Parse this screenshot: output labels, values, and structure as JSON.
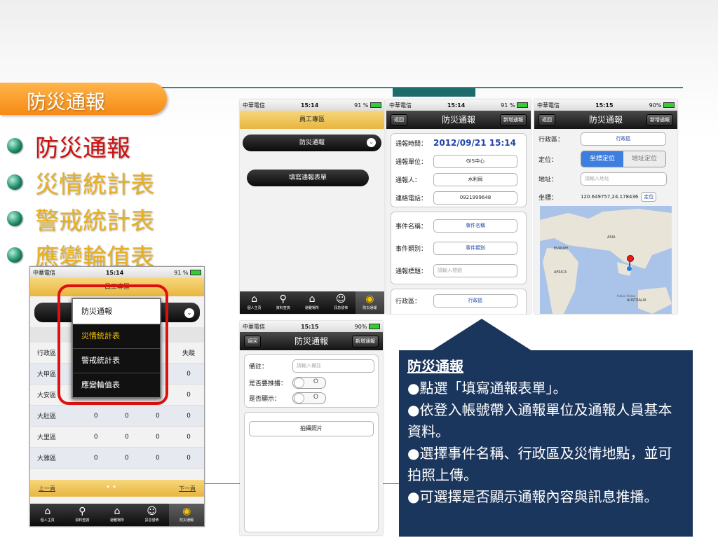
{
  "slide": {
    "title": "防災通報",
    "bullets": [
      {
        "text": "防災通報",
        "color": "#cc1111"
      },
      {
        "text": "災情統計表",
        "color": "#e8b020"
      },
      {
        "text": "警戒統計表",
        "color": "#e8b020"
      },
      {
        "text": "應變輪值表",
        "color": "#e8b020"
      }
    ]
  },
  "status": {
    "carrier": "中華電信",
    "time1": "15:14",
    "time2": "15:15",
    "battery1": "91 %",
    "battery2": "90%"
  },
  "phone_menu": {
    "header": "員工專區",
    "dropdown_items": [
      "防災通報",
      "災情統計表",
      "警戒統計表",
      "應變輪值表"
    ],
    "selected_index": 1,
    "table_rows": [
      {
        "name": "行政區",
        "v": [
          "",
          "",
          "",
          "失蹤"
        ]
      },
      {
        "name": "大甲區",
        "v": [
          "",
          "",
          "",
          "0"
        ]
      },
      {
        "name": "大安區",
        "v": [
          "0",
          "0",
          "0",
          "0"
        ]
      },
      {
        "name": "大肚區",
        "v": [
          "0",
          "0",
          "0",
          "0"
        ]
      },
      {
        "name": "大里區",
        "v": [
          "0",
          "0",
          "0",
          "0"
        ]
      },
      {
        "name": "大雅區",
        "v": [
          "0",
          "0",
          "0",
          "0"
        ]
      }
    ],
    "prev": "上一頁",
    "next": "下一頁"
  },
  "tabbar": [
    "個人主頁",
    "資料查詢",
    "避難場所",
    "訊息發佈",
    "防災通報"
  ],
  "phone_a": {
    "header": "員工專區",
    "select_label": "防災通報",
    "button": "填寫通報表單"
  },
  "phone_b": {
    "back": "返回",
    "title": "防災通報",
    "new": "新增通報",
    "time_label": "通報時間：",
    "time_value": "2012/09/21 15:14",
    "unit_label": "通報單位：",
    "unit_value": "GIS中心",
    "person_label": "通報人：",
    "person_value": "水利局",
    "phone_label": "連絡電話：",
    "phone_value": "0921999648",
    "event_name_label": "事件名稱：",
    "event_name_value": "事件名稱",
    "event_type_label": "事件類別：",
    "event_type_value": "事件類別",
    "subject_label": "通報標題：",
    "subject_placeholder": "請輸入標題",
    "district_label": "行政區：",
    "district_value": "行政區"
  },
  "phone_c": {
    "back": "返回",
    "title": "防災通報",
    "new": "新增通報",
    "district_label": "行政區：",
    "district_value": "行政區",
    "locate_label": "定位：",
    "locate_coord": "坐標定位",
    "locate_addr": "地址定位",
    "address_label": "地址：",
    "address_placeholder": "請輸入地址",
    "coord_label": "坐標：",
    "coord_value": "120.649757,24.178436",
    "coord_btn": "定位",
    "map_labels": [
      "ASIA",
      "EUROPE",
      "AFRICA",
      "AUSTRALIA",
      "Indian Ocean"
    ]
  },
  "phone_d": {
    "back": "返回",
    "title": "防災通報",
    "new": "新增通報",
    "note_label": "備註：",
    "note_placeholder": "請輸入備註",
    "push_label": "是否要推播：",
    "show_label": "是否顯示：",
    "photo_btn": "拍攝照片"
  },
  "callout": {
    "heading": "防災通報",
    "lines": [
      "●點選「填寫通報表單」。",
      "●依登入帳號帶入通報單位及通報人員基本資料。",
      "●選擇事件名稱、行政區及災情地點，並可拍照上傳。",
      "●可選擇是否顯示通報內容與訊息推播。"
    ]
  }
}
